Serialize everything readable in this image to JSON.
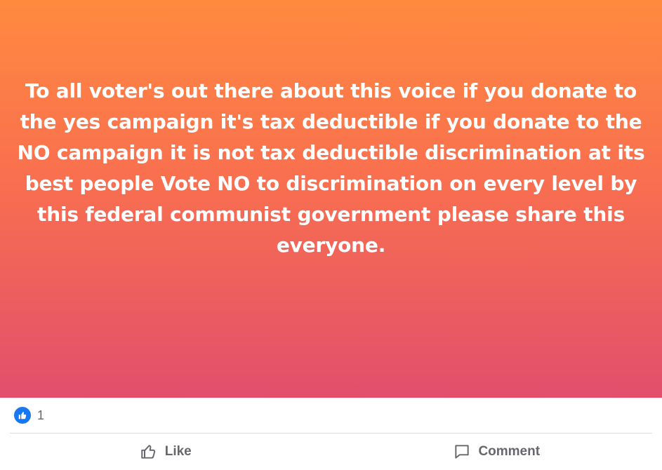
{
  "post": {
    "text": "To all voter's out there about this voice if you donate to the yes campaign it's tax deductible if you donate to the NO campaign it is not tax deductible discrimination at its best people Vote NO to discrimination on every level by this federal communist government please share this everyone."
  },
  "reactions": {
    "icon": "like-icon",
    "count": "1"
  },
  "actions": {
    "like_label": "Like",
    "comment_label": "Comment"
  },
  "colors": {
    "gradient_top": "#ff8a3f",
    "gradient_bottom": "#e14f6c",
    "like_blue": "#1877f2",
    "action_gray": "#65676b"
  }
}
